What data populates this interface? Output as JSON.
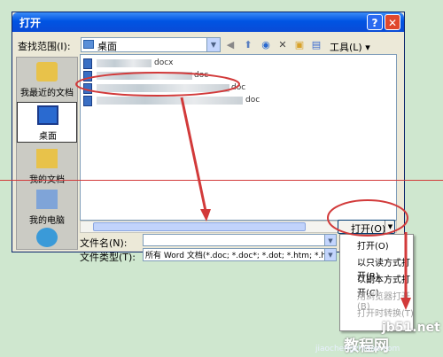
{
  "window": {
    "title": "打开",
    "help_icon": "?",
    "close_icon": "✕"
  },
  "toolbar": {
    "look_in_label": "查找范围(I):",
    "look_in_value": "桌面",
    "tools_label": "工具(L)",
    "icons": [
      "back-icon",
      "up-folder-icon",
      "search-web-icon",
      "delete-icon",
      "new-folder-icon",
      "views-icon"
    ]
  },
  "places": [
    {
      "label": "我最近的文档",
      "icon": "recent-documents-icon"
    },
    {
      "label": "桌面",
      "icon": "desktop-icon"
    },
    {
      "label": "我的文档",
      "icon": "my-documents-icon"
    },
    {
      "label": "我的电脑",
      "icon": "my-computer-icon"
    }
  ],
  "files": [
    {
      "name": "docx"
    },
    {
      "name": "doc"
    },
    {
      "name": "doc"
    },
    {
      "name": "doc"
    }
  ],
  "filename_row": {
    "label": "文件名(N):",
    "value": ""
  },
  "filetype_row": {
    "label": "文件类型(T):",
    "value": "所有 Word 文档(*.doc; *.doc*; *.dot; *.htm; *.ht"
  },
  "open_button": {
    "label": "打开(O)"
  },
  "open_menu": [
    {
      "label": "打开(O)",
      "enabled": true
    },
    {
      "label": "以只读方式打开(R)",
      "enabled": true
    },
    {
      "label": "以副本方式打开(C)",
      "enabled": true
    },
    {
      "label": "用浏览器打开(B)",
      "enabled": false
    },
    {
      "label": "打开时转换(T)",
      "enabled": false
    }
  ],
  "watermark": {
    "site": "jb51.net",
    "brand": "教程网",
    "url": "jiaochengzhidao.com"
  },
  "colors": {
    "annotation_red": "#d23a3a",
    "title_blue": "#0054e3",
    "background": "#cfe7cf"
  }
}
